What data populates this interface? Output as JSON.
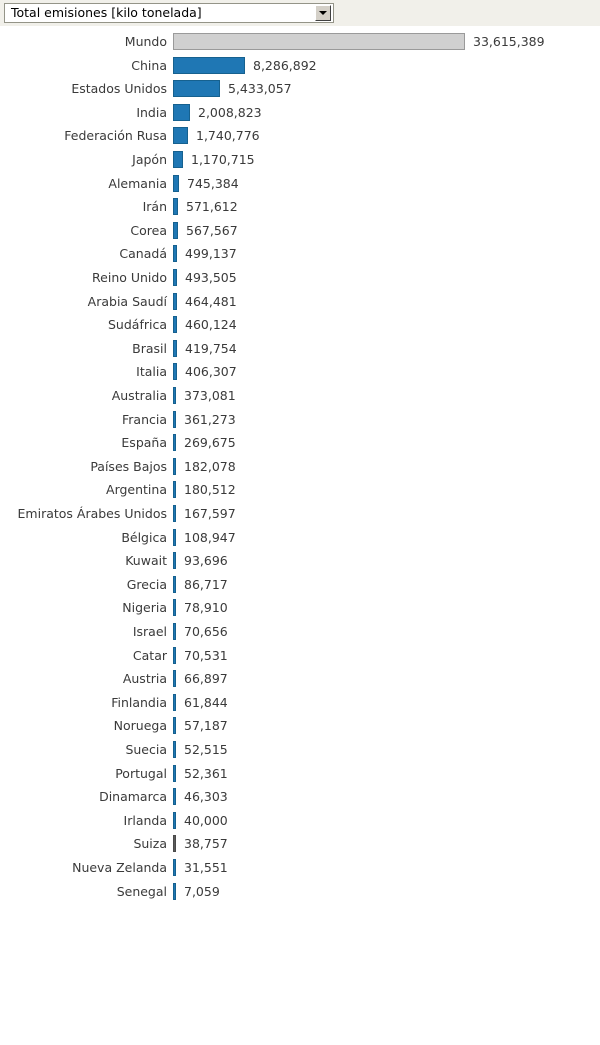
{
  "selector": {
    "value": "Total emisiones [kilo tonelada]",
    "dropdown_icon": "chevron-down-icon"
  },
  "chart_data": {
    "type": "bar",
    "orientation": "horizontal",
    "title": "Total emisiones [kilo tonelada]",
    "xlabel": "",
    "ylabel": "",
    "grid": false,
    "legend": null,
    "value_unit": "kilo tonelada",
    "xlim": [
      0,
      33615389
    ],
    "colors": {
      "bar": "#1f77b4",
      "bar_border": "#16618f",
      "total_bar": "#d0d0d0",
      "total_bar_border": "#9a9a9a",
      "highlight_bar": "#5b5b5b",
      "label_text": "#3a3a3a"
    },
    "categories": [
      "Mundo",
      "China",
      "Estados Unidos",
      "India",
      "Federación Rusa",
      "Japón",
      "Alemania",
      "Irán",
      "Corea",
      "Canadá",
      "Reino Unido",
      "Arabia Saudí",
      "Sudáfrica",
      "Brasil",
      "Italia",
      "Australia",
      "Francia",
      "España",
      "Países Bajos",
      "Argentina",
      "Emiratos Árabes Unidos",
      "Bélgica",
      "Kuwait",
      "Grecia",
      "Nigeria",
      "Israel",
      "Catar",
      "Austria",
      "Finlandia",
      "Noruega",
      "Suecia",
      "Portugal",
      "Dinamarca",
      "Irlanda",
      "Suiza",
      "Nueva Zelanda",
      "Senegal"
    ],
    "values": [
      33615389,
      8286892,
      5433057,
      2008823,
      1740776,
      1170715,
      745384,
      571612,
      567567,
      499137,
      493505,
      464481,
      460124,
      419754,
      406307,
      373081,
      361273,
      269675,
      182078,
      180512,
      167597,
      108947,
      93696,
      86717,
      78910,
      70656,
      70531,
      66897,
      61844,
      57187,
      52515,
      52361,
      46303,
      40000,
      38757,
      31551,
      7059
    ],
    "value_labels": [
      "33,615,389",
      "8,286,892",
      "5,433,057",
      "2,008,823",
      "1,740,776",
      "1,170,715",
      "745,384",
      "571,612",
      "567,567",
      "499,137",
      "493,505",
      "464,481",
      "460,124",
      "419,754",
      "406,307",
      "373,081",
      "361,273",
      "269,675",
      "182,078",
      "180,512",
      "167,597",
      "108,947",
      "93,696",
      "86,717",
      "78,910",
      "70,656",
      "70,531",
      "66,897",
      "61,844",
      "57,187",
      "52,515",
      "52,361",
      "46,303",
      "40,000",
      "38,757",
      "31,551",
      "7,059"
    ],
    "styles": [
      "total",
      "",
      "",
      "",
      "",
      "",
      "",
      "",
      "",
      "",
      "",
      "",
      "",
      "",
      "",
      "",
      "",
      "",
      "",
      "",
      "",
      "",
      "",
      "",
      "",
      "",
      "",
      "",
      "",
      "",
      "",
      "",
      "",
      "",
      "muted",
      "",
      ""
    ]
  }
}
